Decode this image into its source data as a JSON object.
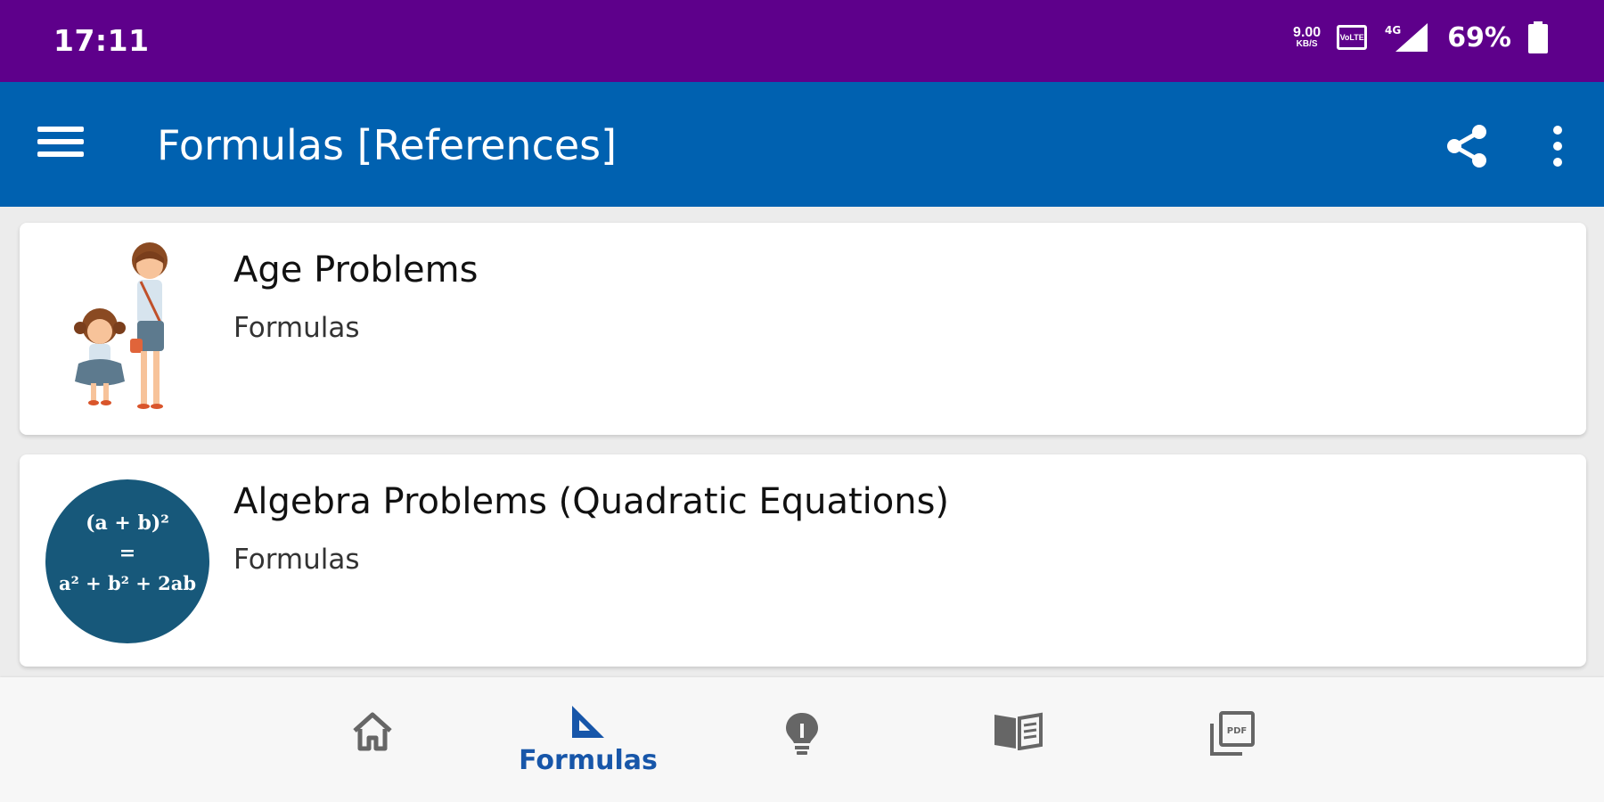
{
  "status_bar": {
    "time": "17:11",
    "network_speed": "9.00",
    "network_unit": "KB/S",
    "volte": "VoLTE",
    "signal": "4G",
    "battery": "69%"
  },
  "app_bar": {
    "title": "Formulas [References]",
    "menu_icon": "hamburger-menu-icon",
    "share_icon": "share-icon",
    "more_icon": "more-vertical-icon"
  },
  "cards": [
    {
      "title": "Age Problems",
      "subtitle": "Formulas",
      "image": "age-problems-illustration"
    },
    {
      "title": "Algebra Problems (Quadratic Equations)",
      "subtitle": "Formulas",
      "image": "algebra-formula-badge",
      "badge_lines": [
        "(a + b)²",
        "=",
        "a² + b² + 2ab"
      ]
    }
  ],
  "bottom_nav": {
    "items": [
      {
        "icon": "home-icon",
        "label": ""
      },
      {
        "icon": "set-square-icon",
        "label": "Formulas",
        "active": true
      },
      {
        "icon": "lightbulb-icon",
        "label": ""
      },
      {
        "icon": "book-icon",
        "label": ""
      },
      {
        "icon": "pdf-icon",
        "label": ""
      }
    ]
  },
  "colors": {
    "status_bar": "#5e008b",
    "app_bar": "#0061b0",
    "active_nav": "#1756a9",
    "inactive_nav": "#666666",
    "badge_bg": "#17587a"
  }
}
